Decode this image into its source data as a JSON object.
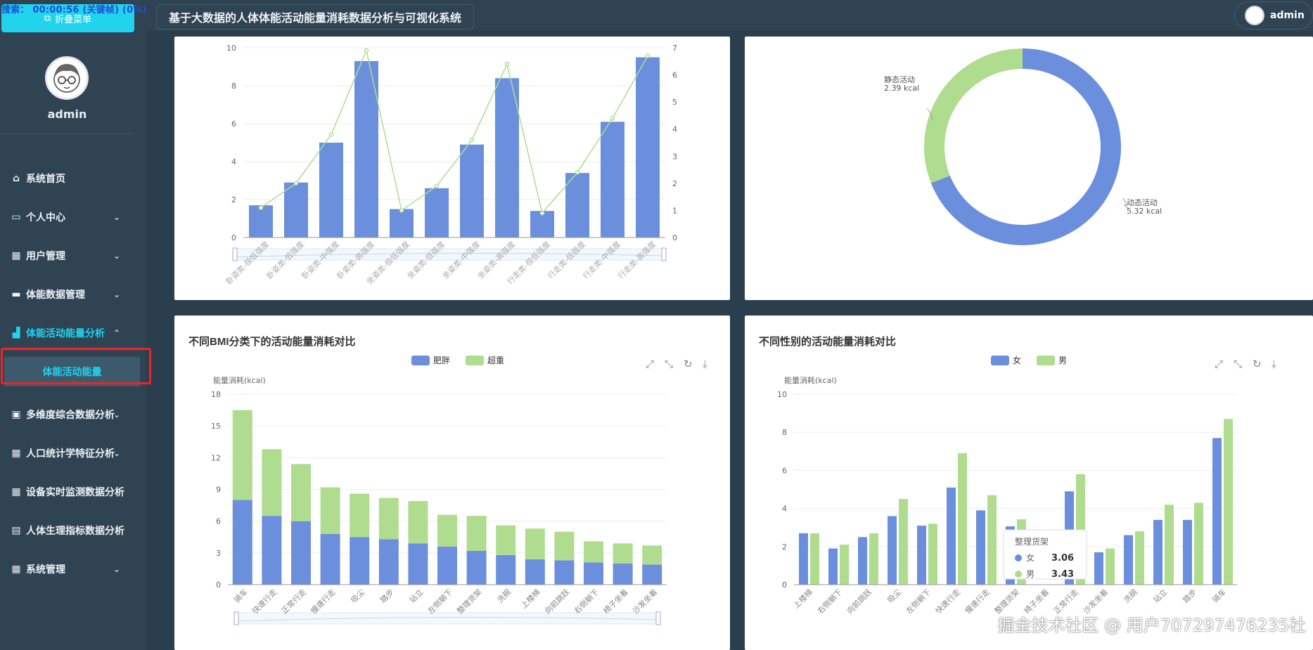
{
  "overlay": {
    "text": "搜索：  00:00:56 (关键帧) (0%)"
  },
  "sidebar": {
    "collapse_label": "折叠菜单",
    "user_name": "admin",
    "items": [
      {
        "label": "系统首页",
        "icon": "home-icon",
        "chevron": ""
      },
      {
        "label": "个人中心",
        "icon": "card-icon",
        "chevron": "⌄"
      },
      {
        "label": "用户管理",
        "icon": "grid-icon",
        "chevron": "⌄"
      },
      {
        "label": "体能数据管理",
        "icon": "ticket-icon",
        "chevron": "⌄"
      },
      {
        "label": "体能活动能量分析",
        "icon": "chart-icon",
        "chevron": "⌃"
      },
      {
        "label": "多维度综合数据分析",
        "icon": "briefcase-icon",
        "chevron": "⌄"
      },
      {
        "label": "人口统计学特征分析",
        "icon": "grid-icon",
        "chevron": "⌄"
      },
      {
        "label": "设备实时监测数据分析",
        "icon": "grid-icon",
        "chevron": ""
      },
      {
        "label": "人体生理指标数据分析",
        "icon": "clipboard-icon",
        "chevron": ""
      },
      {
        "label": "系统管理",
        "icon": "grid-icon",
        "chevron": "⌄"
      }
    ],
    "active_submenu": "体能活动能量"
  },
  "header": {
    "title": "基于大数据的人体体能活动能量消耗数据分析与可视化系统",
    "user": "admin"
  },
  "watermark": "掘金技术社区 @ 用户707297476235社",
  "colors": {
    "blue": "#6b8fdc",
    "green": "#afdc8f",
    "accent": "#22d3ee"
  },
  "chart_data": [
    {
      "type": "bar",
      "title": "",
      "categories": [
        "卧姿类-极低强度",
        "卧姿类-低强度",
        "卧姿类-中强度",
        "卧姿类-高强度",
        "坐姿类-极低强度",
        "坐姿类-低强度",
        "坐姿类-中强度",
        "坐姿类-高强度",
        "行走类-极低强度",
        "行走类-低强度",
        "行走类-中强度",
        "行走类-高强度"
      ],
      "series": [
        {
          "type": "bar",
          "axis": "left",
          "values": [
            1.7,
            2.9,
            5.0,
            9.3,
            1.5,
            2.6,
            4.9,
            8.4,
            1.4,
            3.4,
            6.1,
            9.5
          ]
        },
        {
          "type": "line",
          "axis": "right",
          "values": [
            1.1,
            2.0,
            3.8,
            6.9,
            1.0,
            1.9,
            3.6,
            6.4,
            0.9,
            2.4,
            4.4,
            6.7
          ]
        }
      ],
      "ylim": [
        0,
        10
      ],
      "yticks": [
        0,
        2,
        4,
        6,
        8,
        10
      ],
      "y2lim": [
        0,
        7
      ],
      "y2ticks": [
        0,
        1,
        2,
        3,
        4,
        5,
        6,
        7
      ]
    },
    {
      "type": "pie",
      "slices": [
        {
          "label": "动态活动",
          "value_text": "5.32 kcal",
          "value": 5.32,
          "color": "#6b8fdc"
        },
        {
          "label": "静态活动",
          "value_text": "2.39 kcal",
          "value": 2.39,
          "color": "#afdc8f"
        }
      ]
    },
    {
      "type": "bar",
      "stacked": true,
      "title": "不同BMI分类下的活动能量消耗对比",
      "ylabel": "能量消耗(kcal)",
      "categories": [
        "骑车",
        "快速行走",
        "正常行走",
        "慢速行走",
        "吸尘",
        "踏步",
        "站立",
        "左侧躺下",
        "整理货架",
        "洗碗",
        "上楼梯",
        "向前跳跃",
        "右侧躺下",
        "椅子坐着",
        "沙发坐着"
      ],
      "series": [
        {
          "name": "肥胖",
          "color": "#6b8fdc",
          "values": [
            8.0,
            6.5,
            6.0,
            4.8,
            4.5,
            4.3,
            3.9,
            3.6,
            3.2,
            2.8,
            2.4,
            2.3,
            2.1,
            2.0,
            1.9
          ]
        },
        {
          "name": "超重",
          "color": "#afdc8f",
          "values": [
            8.5,
            6.3,
            5.4,
            4.4,
            4.1,
            3.9,
            4.0,
            3.0,
            3.3,
            2.8,
            2.9,
            2.7,
            2.0,
            1.9,
            1.8
          ]
        }
      ],
      "ylim": [
        0,
        18
      ],
      "yticks": [
        0,
        3,
        6,
        9,
        12,
        15,
        18
      ]
    },
    {
      "type": "bar",
      "title": "不同性别的活动能量消耗对比",
      "ylabel": "能量消耗(kcal)",
      "categories": [
        "上楼梯",
        "右侧躺下",
        "向前跳跃",
        "吸尘",
        "左侧躺下",
        "快速行走",
        "慢速行走",
        "整理货架",
        "椅子坐着",
        "正常行走",
        "沙发坐着",
        "洗碗",
        "站立",
        "踏步",
        "骑车"
      ],
      "series": [
        {
          "name": "女",
          "color": "#6b8fdc",
          "values": [
            2.7,
            1.9,
            2.5,
            3.6,
            3.1,
            5.1,
            3.9,
            3.06,
            0,
            4.9,
            1.7,
            2.6,
            3.4,
            3.4,
            7.7
          ]
        },
        {
          "name": "男",
          "color": "#afdc8f",
          "values": [
            2.7,
            2.1,
            2.7,
            4.5,
            3.2,
            6.9,
            4.7,
            3.43,
            0,
            5.8,
            1.9,
            2.8,
            4.2,
            4.3,
            8.7
          ]
        }
      ],
      "ylim": [
        0,
        10
      ],
      "yticks": [
        0,
        2,
        4,
        6,
        8,
        10
      ],
      "tooltip": {
        "title": "整理货架",
        "rows": [
          {
            "name": "女",
            "value": "3.06"
          },
          {
            "name": "男",
            "value": "3.43"
          }
        ]
      }
    }
  ]
}
